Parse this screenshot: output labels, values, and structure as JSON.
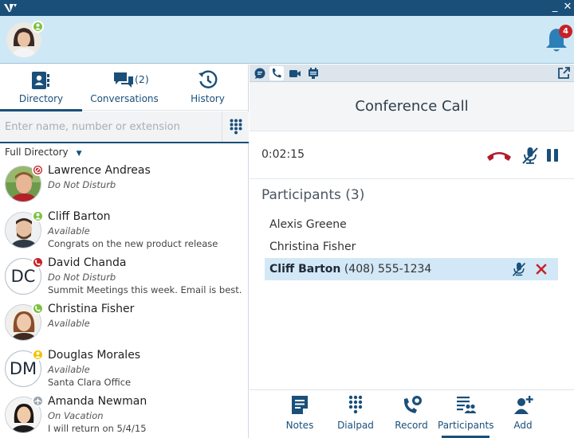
{
  "titlebar": {
    "minimize_glyph": "_",
    "close_glyph": "✕"
  },
  "header": {
    "notifications_count": "4"
  },
  "tabs": [
    {
      "label": "Directory",
      "badge": "",
      "icon": "contact-card-icon"
    },
    {
      "label": "Conversations",
      "badge": "(2)",
      "icon": "chat-bubbles-icon"
    },
    {
      "label": "History",
      "badge": "",
      "icon": "history-clock-icon"
    }
  ],
  "search": {
    "placeholder": "Enter name, number or extension"
  },
  "filter": {
    "label": "Full Directory"
  },
  "contacts": [
    {
      "name": "Lawrence Andreas",
      "status": "Do Not Disturb",
      "note": "",
      "initials": "",
      "presence": "dnd"
    },
    {
      "name": "Cliff Barton",
      "status": "Available",
      "note": "Congrats on the new product release",
      "initials": "",
      "presence": "available"
    },
    {
      "name": "David Chanda",
      "status": "Do Not Disturb",
      "note": "Summit Meetings this week. Email is best.",
      "initials": "DC",
      "presence": "dnd-phone"
    },
    {
      "name": "Christina Fisher",
      "status": "Available",
      "note": "",
      "initials": "",
      "presence": "on-call"
    },
    {
      "name": "Douglas Morales",
      "status": "Available",
      "note": "Santa Clara Office",
      "initials": "DM",
      "presence": "away"
    },
    {
      "name": "Amanda Newman",
      "status": "On Vacation",
      "note": "I will return on 5/4/15",
      "initials": "",
      "presence": "travel"
    }
  ],
  "call": {
    "title": "Conference Call",
    "timer": "0:02:15",
    "participants_title": "Participants (3)",
    "participants": [
      {
        "name": "Alexis Greene",
        "number": ""
      },
      {
        "name": "Christina Fisher",
        "number": ""
      },
      {
        "name": "Cliff Barton",
        "number": "(408) 555-1234"
      }
    ]
  },
  "bottom_bar": [
    {
      "label": "Notes",
      "icon": "notes-icon"
    },
    {
      "label": "Dialpad",
      "icon": "dialpad-icon"
    },
    {
      "label": "Record",
      "icon": "record-icon"
    },
    {
      "label": "Participants",
      "icon": "participants-icon"
    },
    {
      "label": "Add",
      "icon": "add-person-icon"
    }
  ],
  "colors": {
    "brand": "#1a4f7a",
    "header_bg": "#cfe8f6",
    "hangup": "#b31b2c",
    "available": "#7cc242",
    "dnd": "#c62128",
    "away": "#f2c200",
    "selected_row": "#d2e8f6"
  }
}
